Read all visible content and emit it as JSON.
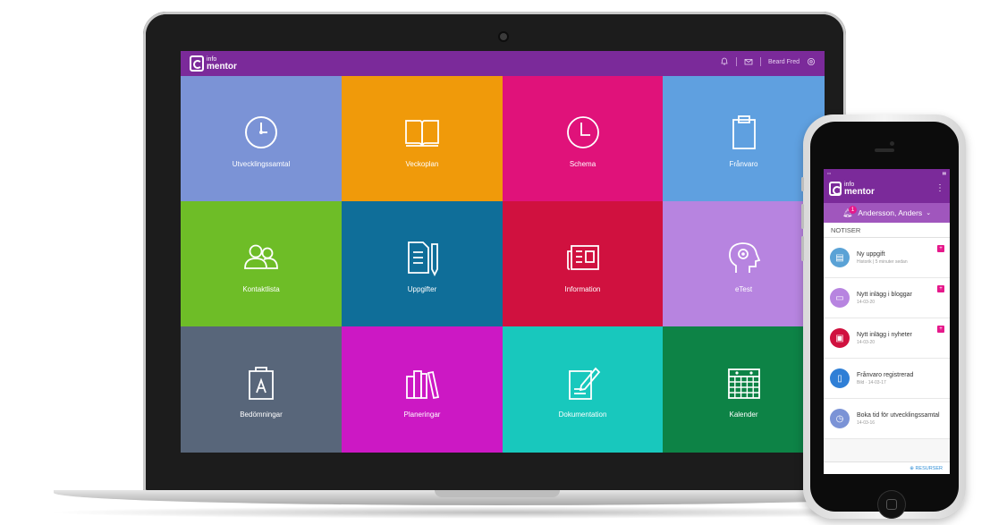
{
  "app": {
    "logo_small": "info",
    "logo_big": "mentor",
    "user_name": "Beard Fred"
  },
  "tiles": [
    {
      "label": "Utvecklingssamtal",
      "color": "#7b93d6",
      "icon": "clock-icon"
    },
    {
      "label": "Veckoplan",
      "color": "#f09a0a",
      "icon": "open-book-icon"
    },
    {
      "label": "Schema",
      "color": "#e0127a",
      "icon": "clock-outline-icon"
    },
    {
      "label": "Frånvaro",
      "color": "#5fa0e0",
      "icon": "clipboard-icon"
    },
    {
      "label": "Kontaktlista",
      "color": "#6ebd27",
      "icon": "contacts-icon"
    },
    {
      "label": "Uppgifter",
      "color": "#0f6e99",
      "icon": "document-pencil-icon"
    },
    {
      "label": "Information",
      "color": "#d0113f",
      "icon": "newspaper-icon"
    },
    {
      "label": "eTest",
      "color": "#b784e0",
      "icon": "head-gear-icon"
    },
    {
      "label": "Bedömningar",
      "color": "#58667a",
      "icon": "clipboard-a-icon"
    },
    {
      "label": "Planeringar",
      "color": "#cc18c4",
      "icon": "books-icon"
    },
    {
      "label": "Dokumentation",
      "color": "#18c8bd",
      "icon": "document-edit-icon"
    },
    {
      "label": "Kalender",
      "color": "#0d8346",
      "icon": "calendar-icon"
    }
  ],
  "phone": {
    "logo_small": "info",
    "logo_big": "mentor",
    "user": "Andersson, Anders",
    "badge": "1",
    "section": "NOTISER",
    "notifications": [
      {
        "title": "Ny uppgift",
        "sub": "Historik  |  5 minuter sedan",
        "color": "#5aa2d6",
        "icon": "document-icon",
        "flag": "+"
      },
      {
        "title": "Nytt inlägg i bloggar",
        "sub": "14-03-20",
        "color": "#b784e0",
        "icon": "comment-icon",
        "flag": "+"
      },
      {
        "title": "Nytt inlägg i nyheter",
        "sub": "14-03-20",
        "color": "#d0113f",
        "icon": "newspaper-icon",
        "flag": "+"
      },
      {
        "title": "Frånvaro registrerad",
        "sub": "Bild  ·  14-03-17",
        "color": "#2f7fd6",
        "icon": "clipboard-icon",
        "flag": ""
      },
      {
        "title": "Boka tid för utvecklingssamtal",
        "sub": "14-03-16",
        "color": "#7b93d6",
        "icon": "clock-icon",
        "flag": ""
      }
    ],
    "footer": "RESURSER"
  }
}
